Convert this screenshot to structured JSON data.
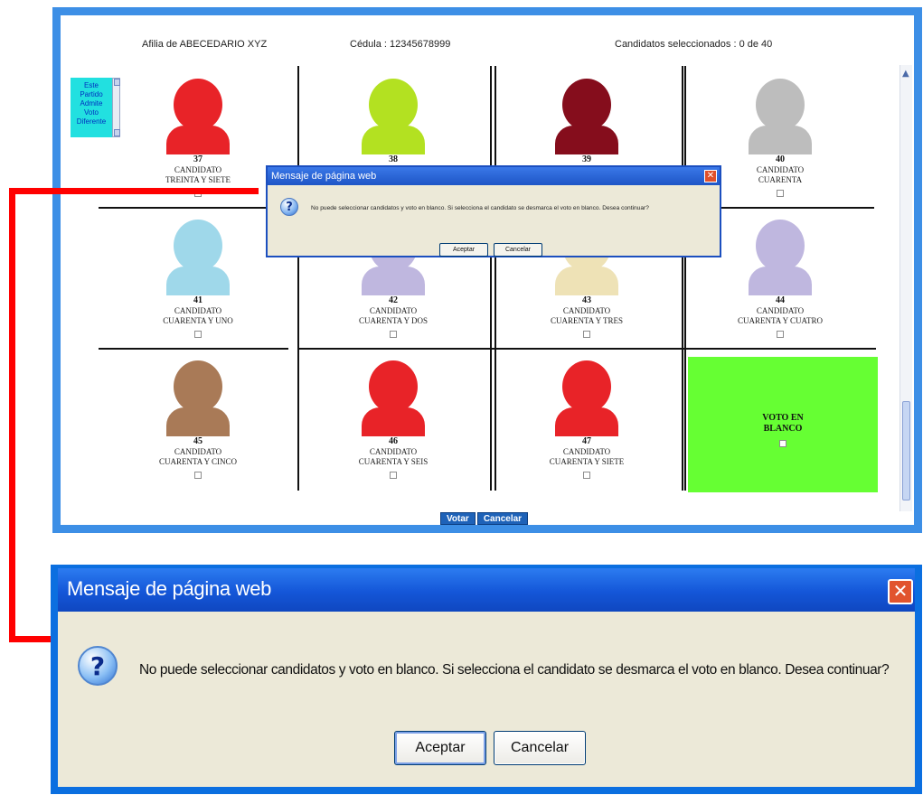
{
  "header": {
    "affiliation": "Afilia de ABECEDARIO XYZ",
    "cedula": "Cédula : 12345678999",
    "count": "Candidatos seleccionados : 0      de 40"
  },
  "info_box": {
    "text": "Este Partido Admite Voto Diferente"
  },
  "candidates": [
    {
      "number": "37",
      "line1": "CANDIDATO",
      "line2": "TREINTA Y SIETE",
      "color": "#e82328"
    },
    {
      "number": "38",
      "line1": "",
      "line2": "",
      "color": "#b3e121"
    },
    {
      "number": "39",
      "line1": "",
      "line2": "",
      "color": "#850d1c"
    },
    {
      "number": "40",
      "line1": "CANDIDATO",
      "line2": "CUARENTA",
      "color": "#bdbdbd"
    },
    {
      "number": "41",
      "line1": "CANDIDATO",
      "line2": "CUARENTA Y UNO",
      "color": "#9fd8ea"
    },
    {
      "number": "42",
      "line1": "CANDIDATO",
      "line2": "CUARENTA Y DOS",
      "color": "#bfb7df"
    },
    {
      "number": "43",
      "line1": "CANDIDATO",
      "line2": "CUARENTA Y TRES",
      "color": "#eee2b6"
    },
    {
      "number": "44",
      "line1": "CANDIDATO",
      "line2": "CUARENTA Y CUATRO",
      "color": "#bfb7df"
    },
    {
      "number": "45",
      "line1": "CANDIDATO",
      "line2": "CUARENTA Y CINCO",
      "color": "#a97a57"
    },
    {
      "number": "46",
      "line1": "CANDIDATO",
      "line2": "CUARENTA Y SEIS",
      "color": "#e82328"
    },
    {
      "number": "47",
      "line1": "CANDIDATO",
      "line2": "CUARENTA Y SIETE",
      "color": "#e82328"
    }
  ],
  "blank_vote": {
    "line1": "VOTO EN",
    "line2": "BLANCO",
    "color": "#66ff33"
  },
  "actions": {
    "vote": "Votar",
    "cancel": "Cancelar"
  },
  "dialog": {
    "title": "Mensaje de página web",
    "message": "No puede seleccionar candidatos y voto en blanco. Si selecciona el candidato se desmarca el voto en blanco. Desea continuar?",
    "accept": "Aceptar",
    "cancel": "Cancelar"
  }
}
